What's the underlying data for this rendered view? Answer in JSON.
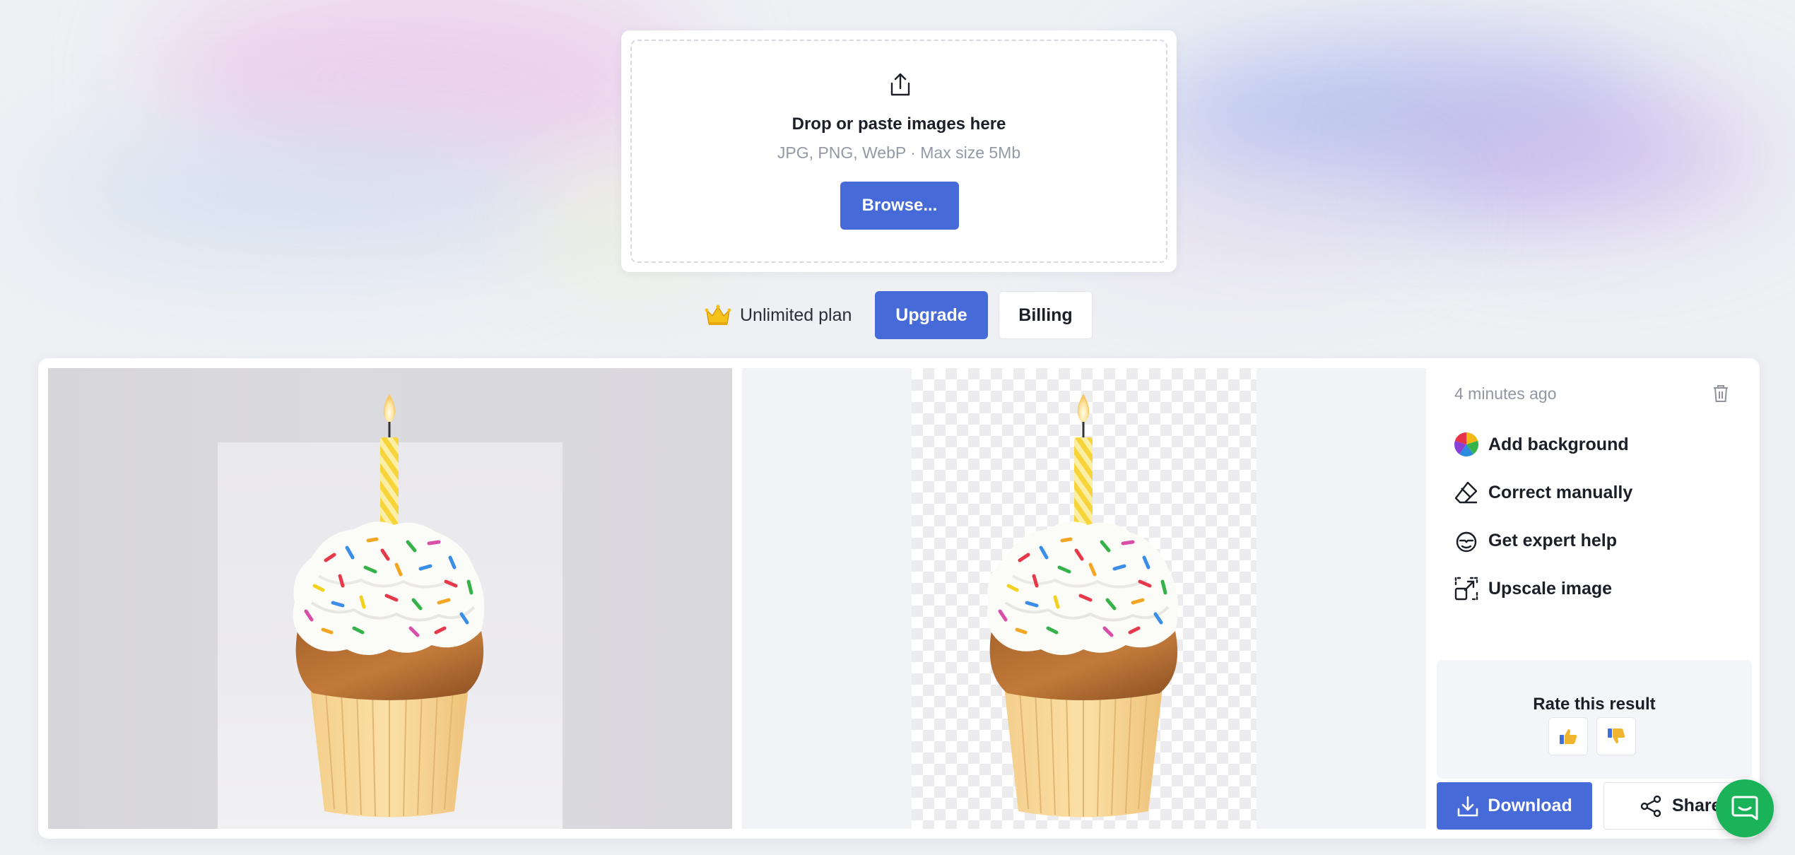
{
  "upload": {
    "title": "Drop or paste images here",
    "subtitle": "JPG, PNG, WebP · Max size 5Mb",
    "browse_label": "Browse...",
    "icon": "upload-icon"
  },
  "plan": {
    "icon": "crown-icon",
    "label": "Unlimited plan",
    "upgrade_label": "Upgrade",
    "billing_label": "Billing"
  },
  "result": {
    "time_ago": "4 minutes ago",
    "actions": [
      {
        "label": "Add background",
        "icon": "color-wheel-icon"
      },
      {
        "label": "Correct manually",
        "icon": "eraser-icon"
      },
      {
        "label": "Get expert help",
        "icon": "expert-icon"
      },
      {
        "label": "Upscale image",
        "icon": "upscale-icon"
      }
    ],
    "rate_title": "Rate this result",
    "download_label": "Download",
    "share_label": "Share"
  },
  "colors": {
    "accent": "#466ad8",
    "chat": "#1bb35a"
  }
}
